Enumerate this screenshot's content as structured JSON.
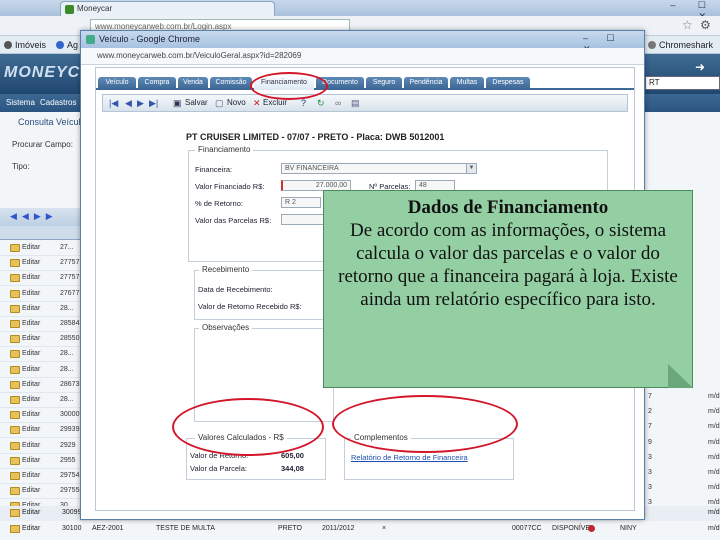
{
  "browser": {
    "tab_title": "Moneycar",
    "url": "www.moneycarweb.com.br/Login.aspx",
    "window_controls": "– ☐ ✕",
    "bookmarks": [
      "Imóveis",
      "Ag",
      "Chromeshark"
    ]
  },
  "app": {
    "logo": "MONEYCA",
    "menu": [
      "Sistema",
      "Cadastros"
    ],
    "right_select": "RT",
    "consulta_title": "Consulta Veícul",
    "proc_label": "Procurar Campo:",
    "tipo_label": "Tipo:",
    "grid_rows": [
      {
        "edit": "Editar",
        "code": "27..."
      },
      {
        "edit": "Editar",
        "code": "27757"
      },
      {
        "edit": "Editar",
        "code": "27757"
      },
      {
        "edit": "Editar",
        "code": "27677"
      },
      {
        "edit": "Editar",
        "code": "28..."
      },
      {
        "edit": "Editar",
        "code": "28584"
      },
      {
        "edit": "Editar",
        "code": "28550"
      },
      {
        "edit": "Editar",
        "code": "28..."
      },
      {
        "edit": "Editar",
        "code": "28..."
      },
      {
        "edit": "Editar",
        "code": "28673"
      },
      {
        "edit": "Editar",
        "code": "28..."
      },
      {
        "edit": "Editar",
        "code": "30000"
      },
      {
        "edit": "Editar",
        "code": "29939"
      },
      {
        "edit": "Editar",
        "code": "2929"
      },
      {
        "edit": "Editar",
        "code": "2955"
      },
      {
        "edit": "Editar",
        "code": "29754"
      },
      {
        "edit": "Editar",
        "code": "29755"
      },
      {
        "edit": "Editar",
        "code": "30..."
      }
    ],
    "right_rows": [
      {
        "a": "7",
        "b": "m/d"
      },
      {
        "a": "2",
        "b": "m/d"
      },
      {
        "a": "7",
        "b": "m/d"
      },
      {
        "a": "9",
        "b": "m/d"
      },
      {
        "a": "3",
        "b": "m/d"
      },
      {
        "a": "3",
        "b": "m/d"
      },
      {
        "a": "3",
        "b": "m/d"
      },
      {
        "a": "3",
        "b": "m/d"
      }
    ],
    "last_rows": [
      {
        "edit": "Editar",
        "code": "30099",
        "plate": "",
        "desc": "TESTE DE VENDA",
        "color": "PRETO",
        "year": "2011/2012",
        "x": "",
        "val": "",
        "status": "DISPONÍVEL",
        "user": "TIPO",
        "md": "m/d"
      },
      {
        "edit": "Editar",
        "code": "30100",
        "plate": "AEZ-2001",
        "desc": "TESTE DE MULTA",
        "color": "PRETO",
        "year": "2011/2012",
        "x": "×",
        "val": "00077CC",
        "status": "DISPONÍVEL",
        "user": "NINY",
        "md": "m/d"
      }
    ]
  },
  "popup": {
    "title": "Veículo - Google Chrome",
    "window_controls": "– ☐ ✕",
    "url": "www.moneycarweb.com.br/VeiculoGeral.aspx?id=282069",
    "tabs": [
      "Veículo",
      "Compra",
      "Venda",
      "Comissão",
      "Financiamento",
      "Documento",
      "Seguro",
      "Pendência",
      "Multas",
      "Despesas"
    ],
    "toolbar": {
      "salvar": "Salvar",
      "novo": "Novo",
      "excluir": "Excluir"
    },
    "vehicle_title": "PT CRUISER LIMITED - 07/07 - PRETO - Placa: DWB 5012001",
    "financiamento": {
      "legend": "Financiamento",
      "financeira_label": "Financeira:",
      "financeira_value": "BV FINANCEIRA",
      "valor_label": "Valor Financiado R$:",
      "valor_value": "27.000,00",
      "parcelas_label": "Nº Parcelas:",
      "parcelas_value": "48",
      "retorno_label": "% de Retorno:",
      "retorno_value": "R 2",
      "valor_parcela_label": "Valor das Parcelas R$:"
    },
    "recebimento": {
      "legend": "Recebimento",
      "data_label": "Data de Recebimento:",
      "retorno_label": "Valor de Retorno Recebido R$:"
    },
    "observacoes": {
      "legend": "Observações"
    },
    "valores": {
      "legend": "Valores Calculados - R$",
      "retorno_label": "Valor de Retorno:",
      "retorno_value": "605,00",
      "parcela_label": "Valor da Parcela:",
      "parcela_value": "344,08"
    },
    "complementos": {
      "legend": "Complementos",
      "link": "Relatório de Retorno de Financeira"
    }
  },
  "callout": {
    "title": "Dados de Financiamento",
    "body": "De acordo com as informações, o sistema calcula o valor das parcelas e o valor do retorno que a financeira pagará à loja. Existe ainda um relatório específico para isto.",
    "color": "#93cfa3"
  },
  "colors": {
    "highlight_oval": "#d3162a",
    "tab_blue": "#3b6592"
  }
}
